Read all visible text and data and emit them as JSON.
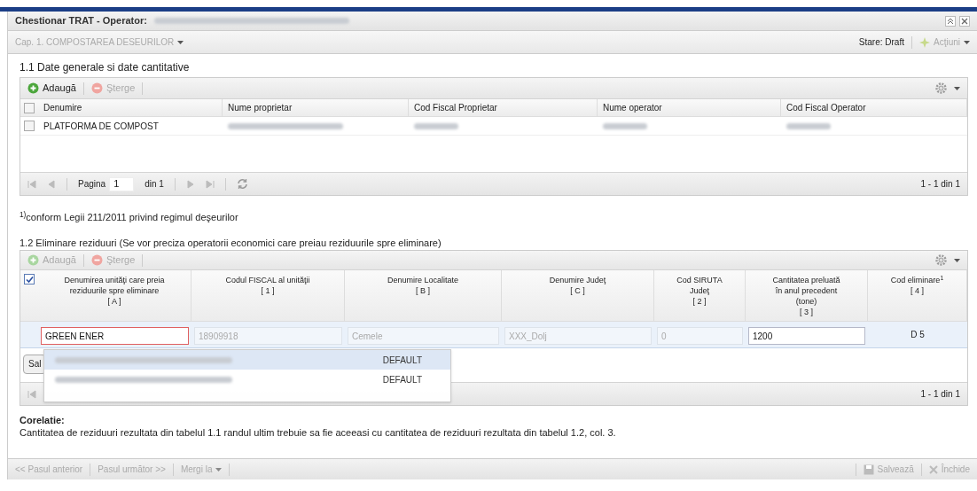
{
  "window": {
    "title": "Chestionar TRAT - Operator:",
    "title_redacted": true
  },
  "toolbar": {
    "chapter": "Cap. 1. COMPOSTAREA DESEURILOR",
    "chapter_disabled": true,
    "status": "Stare: Draft",
    "actions": "Acţiuni",
    "actions_disabled": true
  },
  "section1": {
    "title": "1.1 Date generale si date cantitative",
    "buttons": [
      {
        "label": "Adaugă",
        "kind": "add",
        "disabled": false
      },
      {
        "label": "Şterge",
        "kind": "delete",
        "disabled": true
      }
    ],
    "header_checked": false,
    "columns": [
      "Denumire",
      "Nume proprietar",
      "Cod Fiscal Proprietar",
      "Nume operator",
      "Cod Fiscal Operator"
    ],
    "rows": [
      {
        "checked": false,
        "cells": [
          {
            "kind": "text",
            "value": "PLATFORMA DE COMPOST"
          },
          {
            "kind": "redacted"
          },
          {
            "kind": "redacted"
          },
          {
            "kind": "redacted"
          },
          {
            "kind": "redacted"
          }
        ]
      }
    ],
    "pager": {
      "page_label": "Pagina",
      "page": "1",
      "of": "din 1",
      "summary": "1 - 1 din 1"
    }
  },
  "footnote": "$^{1)}$conform Legii 211/2011 privind regimul deşeurilor",
  "section2": {
    "title": "1.2 Eliminare reziduuri (Se vor preciza operatorii economici care preiau reziduurile spre eliminare)",
    "buttons": [
      {
        "label": "Adaugă",
        "kind": "add",
        "disabled": true
      },
      {
        "label": "Şterge",
        "kind": "delete",
        "disabled": true
      }
    ],
    "header_checked": true,
    "columns": [
      [
        "Denumirea unităţi care preia",
        "reziduurile spre eliminare",
        "[ A ]"
      ],
      [
        "Codul FISCAL al unităţii",
        "[ 1 ]"
      ],
      [
        "Denumire Localitate",
        "[ B ]"
      ],
      [
        "Denumire Judeţ",
        "[ C ]"
      ],
      [
        "Cod SIRUTA",
        "Judeţ",
        "[ 2 ]"
      ],
      [
        "Cantitatea preluată",
        "în anul precedent",
        "(tone)",
        "[ 3 ]"
      ],
      [
        "Cod eliminare$^{1}$",
        "[ 4 ]"
      ]
    ],
    "edit_row": [
      {
        "kind": "field",
        "value": "GREEN ENER",
        "disabled": false,
        "invalid": true
      },
      {
        "kind": "field",
        "value": "18909918",
        "disabled": true,
        "invalid": false
      },
      {
        "kind": "field",
        "value": "Cemele",
        "disabled": true,
        "invalid": false
      },
      {
        "kind": "field",
        "value": "XXX_Dolj",
        "disabled": true,
        "invalid": false
      },
      {
        "kind": "field",
        "value": "0",
        "disabled": true,
        "invalid": false
      },
      {
        "kind": "field",
        "value": "1200",
        "disabled": false,
        "invalid": false
      },
      {
        "kind": "text",
        "value": "D 5"
      }
    ],
    "row_button": "Sal",
    "suggestions": [
      {
        "tag": "DEFAULT",
        "selected": true
      },
      {
        "tag": "DEFAULT",
        "selected": false
      }
    ],
    "pager": {
      "summary": "1 - 1 din 1"
    }
  },
  "correlation": {
    "title": "Corelatie:",
    "text": "Cantitatea de reziduuri rezultata din tabelul 1.1 randul ultim trebuie sa fie aceeasi cu cantitatea de reziduuri rezultata din tabelul 1.2, col. 3."
  },
  "footer": {
    "nav": [
      {
        "label": "<< Pasul anterior",
        "kind": "link",
        "disabled": true
      },
      {
        "label": "Pasul următor >>",
        "kind": "link",
        "disabled": true
      },
      {
        "label": "Mergi la",
        "kind": "menu",
        "disabled": true
      }
    ],
    "actions": [
      {
        "label": "Salvează",
        "kind": "save",
        "disabled": true
      },
      {
        "label": "Închide",
        "kind": "close",
        "disabled": true
      }
    ]
  }
}
